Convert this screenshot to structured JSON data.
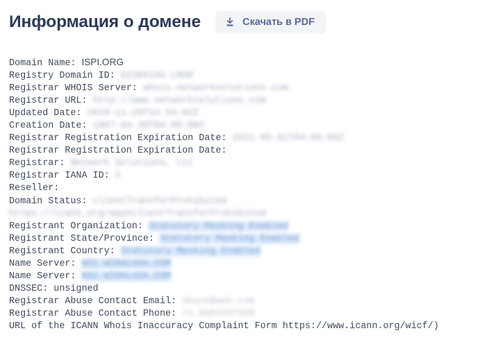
{
  "header": {
    "title": "Информация о домене",
    "pdf_button_label": "Скачать в PDF",
    "pdf_button_icon": "download-icon"
  },
  "colors": {
    "page_background": "#ffffff",
    "title": "#2d3a56",
    "body_text": "#3f4b60",
    "button_background": "#f2f4f7",
    "button_label": "#5b6b96",
    "redaction_highlight": "#d6e7fb",
    "redaction_text": "#5b86c8"
  },
  "whois": {
    "lines": [
      {
        "label": "Domain Name: ",
        "value": "ISPI.ORG",
        "style": "plain"
      },
      {
        "label": "Registry Domain ID: ",
        "value": "D2365166-LROR",
        "style": "blurred"
      },
      {
        "label": "Registrar WHOIS Server: ",
        "value": "whois.networksolutions.com",
        "style": "blurred"
      },
      {
        "label": "Registrar URL: ",
        "value": "http://www.networksolutions.com",
        "style": "blurred"
      },
      {
        "label": "Updated Date: ",
        "value": "2018-11-20T13:54:02Z",
        "style": "blurred"
      },
      {
        "label": "Creation Date: ",
        "value": "1997-04-30T04:00:00Z",
        "style": "blurred"
      },
      {
        "label": "Registrar Registration Expiration Date: ",
        "value": "2021-05-01T04:00:00Z",
        "style": "blurred"
      },
      {
        "label": "Registrar Registration Expiration Date: ",
        "value": "",
        "style": "none"
      },
      {
        "label": "Registrar: ",
        "value": "Network Solutions, LLC",
        "style": "blurred"
      },
      {
        "label": "Registrar IANA ID: ",
        "value": "2",
        "style": "blurred"
      },
      {
        "label": "Reseller: ",
        "value": "",
        "style": "none"
      },
      {
        "label": "Domain Status: ",
        "value": "clientTransferProhibited https://icann.org/epp#clientTransferProhibited",
        "style": "blurred"
      },
      {
        "label": "Registrant Organization: ",
        "value": "Statutory Masking Enabled",
        "style": "blurred-highlight"
      },
      {
        "label": "Registrant State/Province: ",
        "value": "Statutory Masking Enabled",
        "style": "blurred-highlight"
      },
      {
        "label": "Registrant Country: ",
        "value": "Statutory Masking Enabled",
        "style": "blurred-highlight"
      },
      {
        "label": "Name Server: ",
        "value": "NS1.WIRALUSA.COM",
        "style": "blurred-highlight"
      },
      {
        "label": "Name Server: ",
        "value": "NS2.WIRALUSA.COM",
        "style": "blurred-highlight"
      },
      {
        "label": "DNSSEC: unsigned",
        "value": "",
        "style": "none"
      },
      {
        "label": "Registrar Abuse Contact Email: ",
        "value": "abuse@web.com",
        "style": "blurred-gray"
      },
      {
        "label": "Registrar Abuse Contact Phone: ",
        "value": "+1.8003337680",
        "style": "blurred-gray"
      },
      {
        "label": "URL of the ICANN Whois Inaccuracy Complaint Form https://www.icann.org/wicf/)",
        "value": "",
        "style": "none"
      }
    ]
  }
}
